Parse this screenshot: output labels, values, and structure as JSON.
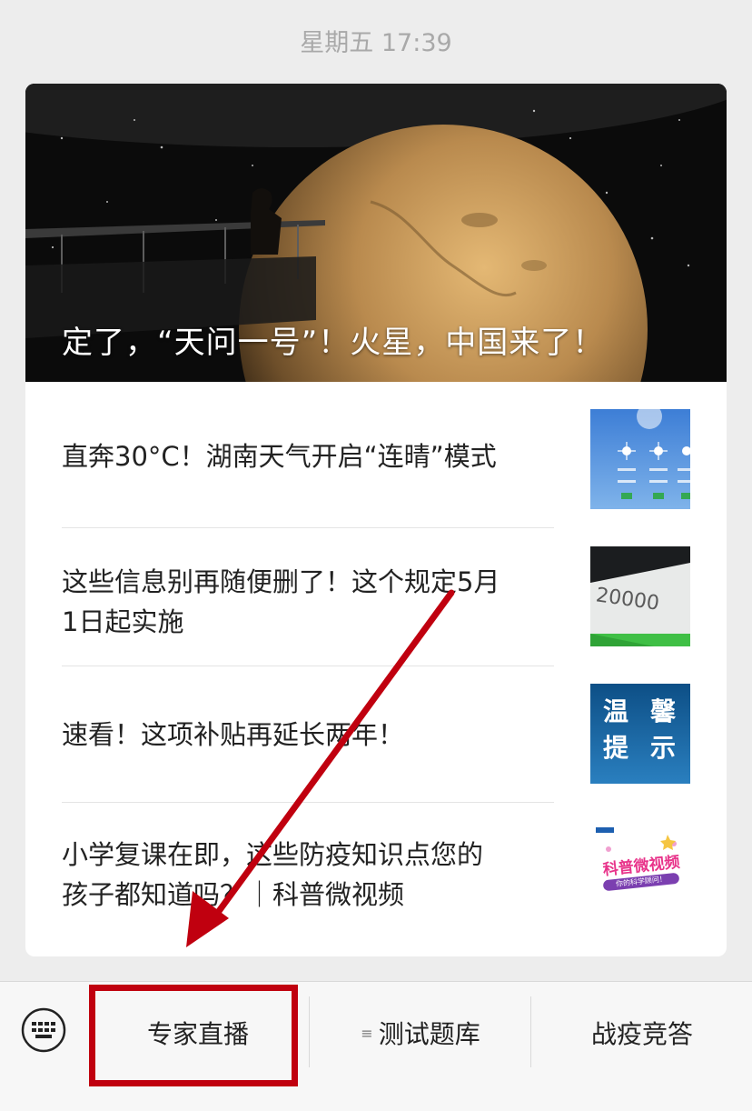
{
  "timestamp": "星期五 17:39",
  "cover": {
    "title": "定了，“天问一号”！火星，中国来了！"
  },
  "articles": [
    {
      "title_lines": [
        "直奔30°C！湖南天气开启“连晴”模式"
      ],
      "thumb": "weather-forecast"
    },
    {
      "title_lines": [
        "这些信息别再随便删了！这个规定5月",
        "1日起实施"
      ],
      "thumb": "phone-20000",
      "thumb_text": "20000"
    },
    {
      "title_lines": [
        "速看！这项补贴再延长两年！"
      ],
      "thumb": "warm-tip",
      "thumb_text": [
        "温",
        "馨",
        "提",
        "示"
      ]
    },
    {
      "title_lines": [
        "小学复课在即，这些防疫知识点您的",
        "孩子都知道吗？｜科普微视频"
      ],
      "thumb": "science-video",
      "thumb_text": "科普微视频",
      "thumb_subtext": "你的科学顾问！"
    }
  ],
  "menu": {
    "items": [
      "专家直播",
      "测试题库",
      "战疫竞答"
    ],
    "list_icon": "≡"
  },
  "colors": {
    "annotation": "#c0000f",
    "background": "#ededed",
    "menu_bg": "#f7f7f7"
  }
}
